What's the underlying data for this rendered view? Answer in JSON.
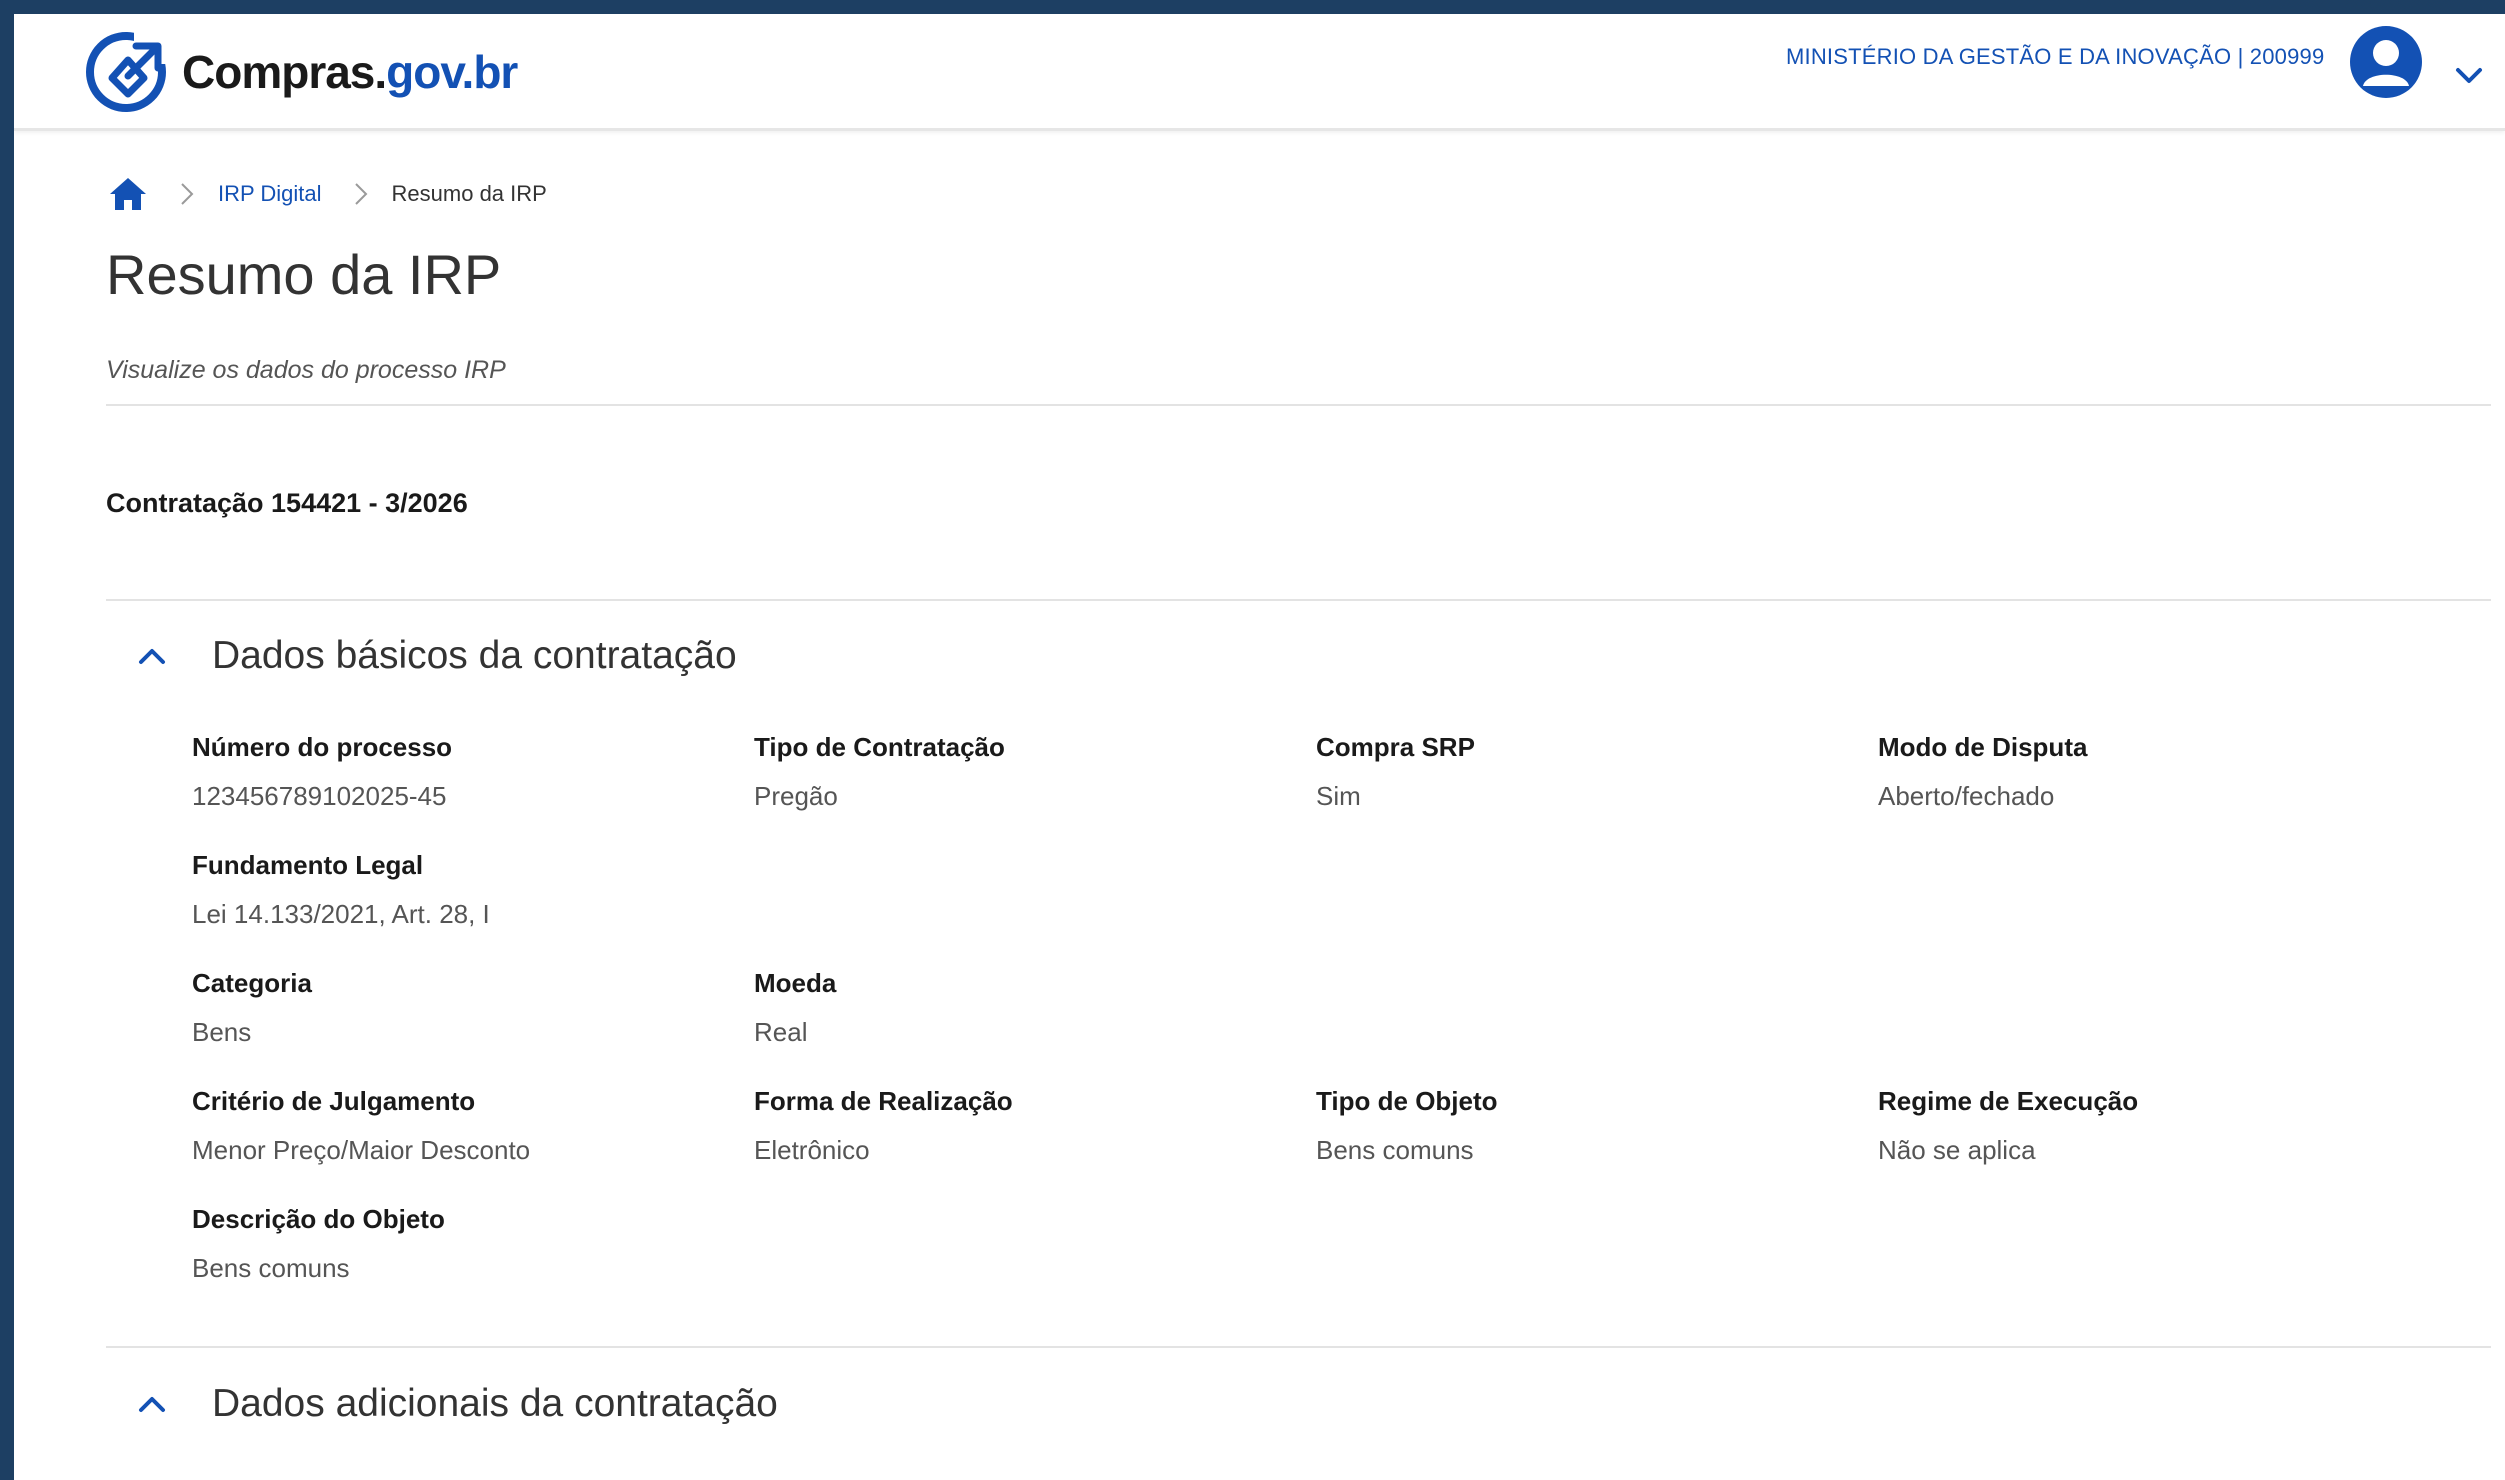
{
  "header": {
    "logo_word1": "Compras.",
    "logo_word2": "gov.br",
    "org_label": "MINISTÉRIO DA GESTÃO E DA INOVAÇÃO | 200999"
  },
  "breadcrumb": {
    "items": [
      "IRP Digital",
      "Resumo da IRP"
    ]
  },
  "page": {
    "title": "Resumo da IRP",
    "subtitle": "Visualize os dados do processo IRP",
    "contract": "Contratação 154421 - 3/2026"
  },
  "sections": {
    "basic": {
      "title": "Dados básicos da contratação",
      "fields": {
        "numero_processo": {
          "label": "Número do processo",
          "value": "123456789102025-45"
        },
        "tipo_contratacao": {
          "label": "Tipo de Contratação",
          "value": "Pregão"
        },
        "compra_srp": {
          "label": "Compra SRP",
          "value": "Sim"
        },
        "modo_disputa": {
          "label": "Modo de Disputa",
          "value": "Aberto/fechado"
        },
        "fundamento_legal": {
          "label": "Fundamento Legal",
          "value": "Lei 14.133/2021, Art. 28, I"
        },
        "categoria": {
          "label": "Categoria",
          "value": "Bens"
        },
        "moeda": {
          "label": "Moeda",
          "value": "Real"
        },
        "criterio_julgamento": {
          "label": "Critério de Julgamento",
          "value": "Menor Preço/Maior Desconto"
        },
        "forma_realizacao": {
          "label": "Forma de Realização",
          "value": "Eletrônico"
        },
        "tipo_objeto": {
          "label": "Tipo de Objeto",
          "value": "Bens comuns"
        },
        "regime_execucao": {
          "label": "Regime de Execução",
          "value": "Não se aplica"
        },
        "descricao_objeto": {
          "label": "Descrição do Objeto",
          "value": "Bens comuns"
        }
      }
    },
    "additional": {
      "title": "Dados adicionais da contratação"
    }
  },
  "icons": {
    "home": "home-icon",
    "breadcrumb_separator": "chevron-right-icon",
    "user": "user-avatar-icon",
    "user_menu": "chevron-down-icon",
    "section_toggle": "chevron-up-icon"
  },
  "colors": {
    "brand_blue": "#1351b4",
    "frame_border": "#1d3f63",
    "text": "#333333"
  }
}
